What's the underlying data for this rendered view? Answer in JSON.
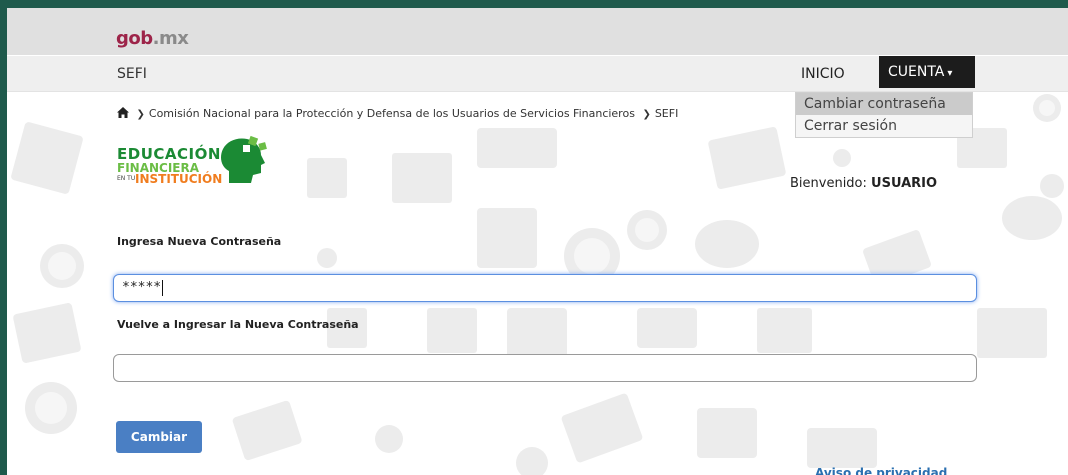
{
  "header": {
    "brand_main": "gob",
    "brand_suffix": ".mx"
  },
  "subnav": {
    "site_name": "SEFI",
    "inicio": "INICIO",
    "cuenta": "CUENTA",
    "caret": "▾"
  },
  "dropdown": {
    "items": [
      {
        "label": "Cambiar contraseña"
      },
      {
        "label": "Cerrar sesión"
      }
    ]
  },
  "breadcrumb": {
    "items": [
      "Comisión Nacional para la Protección y Defensa de los Usuarios de Servicios Financieros",
      "SEFI"
    ]
  },
  "logo": {
    "line1": "EDUCACIÓN",
    "line2": "FINANCIERA",
    "line3": "EN TU",
    "line4": "INSTITUCIÓN"
  },
  "welcome": {
    "prefix": "Bienvenido: ",
    "user": "USUARIO"
  },
  "form": {
    "new_password_label": "Ingresa Nueva Contraseña",
    "new_password_value": "*****",
    "confirm_password_label": "Vuelve a Ingresar la Nueva Contraseña",
    "confirm_password_value": "",
    "submit": "Cambiar"
  },
  "footer_link": "Aviso de privacidad",
  "colors": {
    "frame": "#1f5a4c",
    "brand": "#9d2449",
    "button": "#4a7fc4",
    "dark_nav": "#1c1c1c"
  }
}
